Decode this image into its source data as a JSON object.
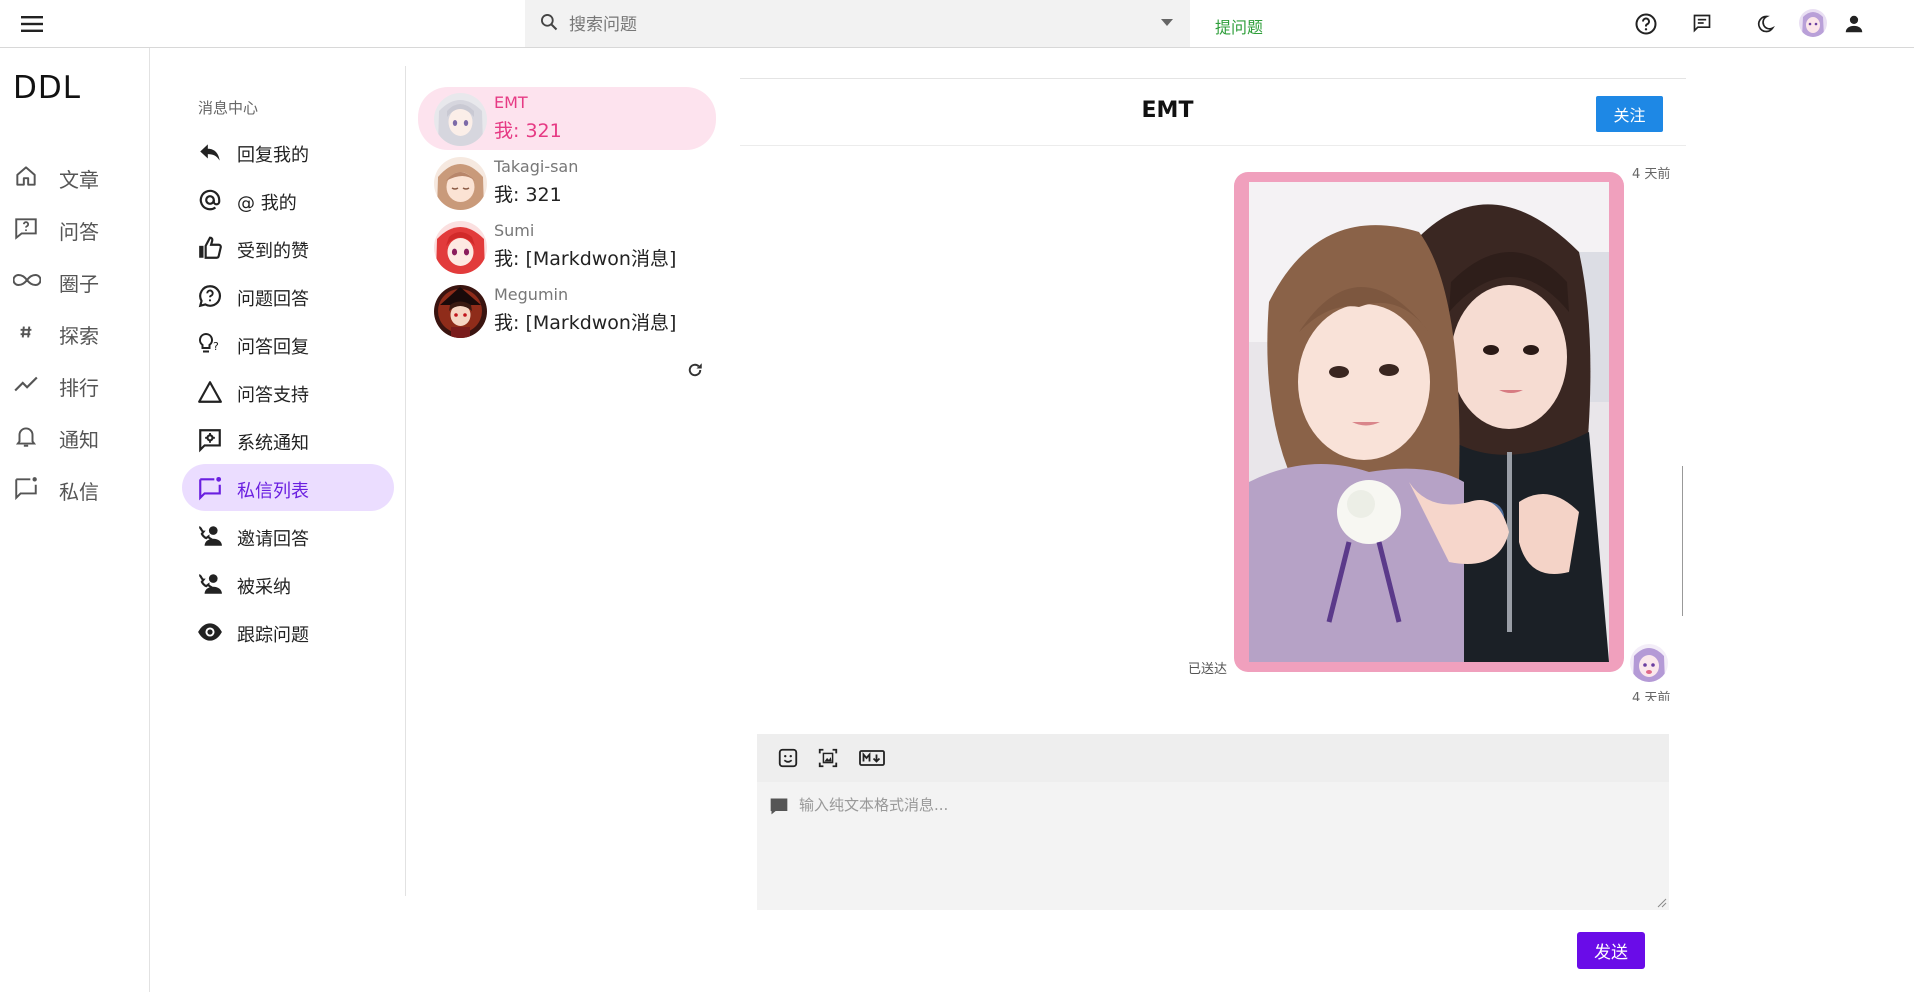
{
  "topbar": {
    "menu_icon": "hamburger-menu-icon",
    "search_placeholder": "搜索问题",
    "ask_link": "提问题",
    "icons": [
      "question-circle-icon",
      "message-icon",
      "dark-mode-icon",
      "user-avatar",
      "account-icon"
    ]
  },
  "sidebar": {
    "brand": "DDL",
    "items": [
      {
        "label": "文章",
        "icon": "home-icon"
      },
      {
        "label": "问答",
        "icon": "question-chat-icon"
      },
      {
        "label": "圈子",
        "icon": "infinity-icon"
      },
      {
        "label": "探索",
        "icon": "hashtag-icon"
      },
      {
        "label": "排行",
        "icon": "trending-icon"
      },
      {
        "label": "通知",
        "icon": "bell-icon"
      },
      {
        "label": "私信",
        "icon": "chat-icon"
      }
    ]
  },
  "message_center": {
    "title": "消息中心",
    "items": [
      {
        "label": "回复我的",
        "icon": "reply-icon"
      },
      {
        "label": "@ 我的",
        "icon": "at-icon"
      },
      {
        "label": "受到的赞",
        "icon": "thumb-up-icon"
      },
      {
        "label": "问题回答",
        "icon": "question-bubble-icon"
      },
      {
        "label": "问答回复",
        "icon": "lightbulb-question-icon"
      },
      {
        "label": "问答支持",
        "icon": "triangle-icon"
      },
      {
        "label": "系统通知",
        "icon": "system-message-icon"
      },
      {
        "label": "私信列表",
        "icon": "chat-list-icon",
        "active": true
      },
      {
        "label": "邀请回答",
        "icon": "phone-person-icon"
      },
      {
        "label": "被采纳",
        "icon": "phone-person-icon"
      },
      {
        "label": "跟踪问题",
        "icon": "eye-icon"
      }
    ]
  },
  "conversations": [
    {
      "name": "EMT",
      "last": "我: 321",
      "active": true
    },
    {
      "name": "Takagi-san",
      "last": "我: 321"
    },
    {
      "name": "Sumi",
      "last": "我: [Markdwon消息]"
    },
    {
      "name": "Megumin",
      "last": "我: [Markdwon消息]"
    }
  ],
  "chat": {
    "title": "EMT",
    "follow_label": "关注",
    "message_time": "4 天前",
    "message_time_2": "4 天前",
    "status": "已送达",
    "composer_placeholder": "输入纯文本格式消息...",
    "send_label": "发送",
    "toolbar": [
      "emoji-icon",
      "image-icon",
      "markdown-icon"
    ]
  },
  "colors": {
    "accent": "#6a0ce8",
    "active_menu_bg": "#ebddff",
    "active_conv_bg": "#fde3ee",
    "active_conv_text": "#e63a84",
    "follow_button": "#1e88e5",
    "ask_link": "#2e9e3a",
    "photo_frame": "#f0a0bd"
  }
}
